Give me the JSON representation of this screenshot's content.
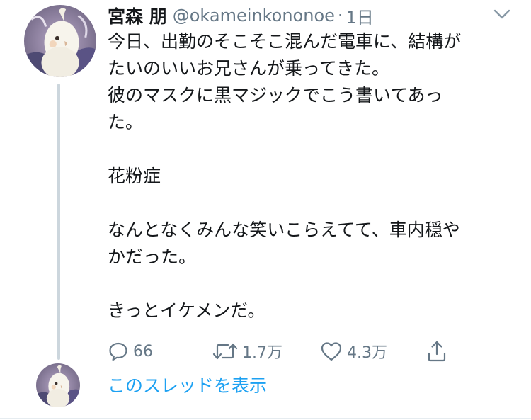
{
  "author": {
    "display_name": "宮森 朋",
    "handle": "@okameinkononoe",
    "separator": "·",
    "time": "1日"
  },
  "tweet": {
    "lines": [
      "今日、出勤のそこそこ混んだ電車に、結構が",
      "たいのいいお兄さんが乗ってきた。",
      "彼のマスクに黒マジックでこう書いてあっ",
      "た。",
      "",
      "花粉症",
      "",
      "なんとなくみんな笑いこらえてて、車内穏や",
      "かだった。",
      "",
      "きっとイケメンだ。"
    ]
  },
  "actions": {
    "reply_count": "66",
    "retweet_count": "1.7万",
    "like_count": "4.3万"
  },
  "thread": {
    "show_thread_label": "このスレッドを表示"
  },
  "icons": {
    "reply": "reply-icon",
    "retweet": "retweet-icon",
    "like": "heart-icon",
    "share": "share-icon",
    "more": "chevron-down-icon"
  },
  "colors": {
    "text": "#14171a",
    "muted": "#657786",
    "link": "#1da1f2",
    "thread_line": "#ccd6dd"
  }
}
